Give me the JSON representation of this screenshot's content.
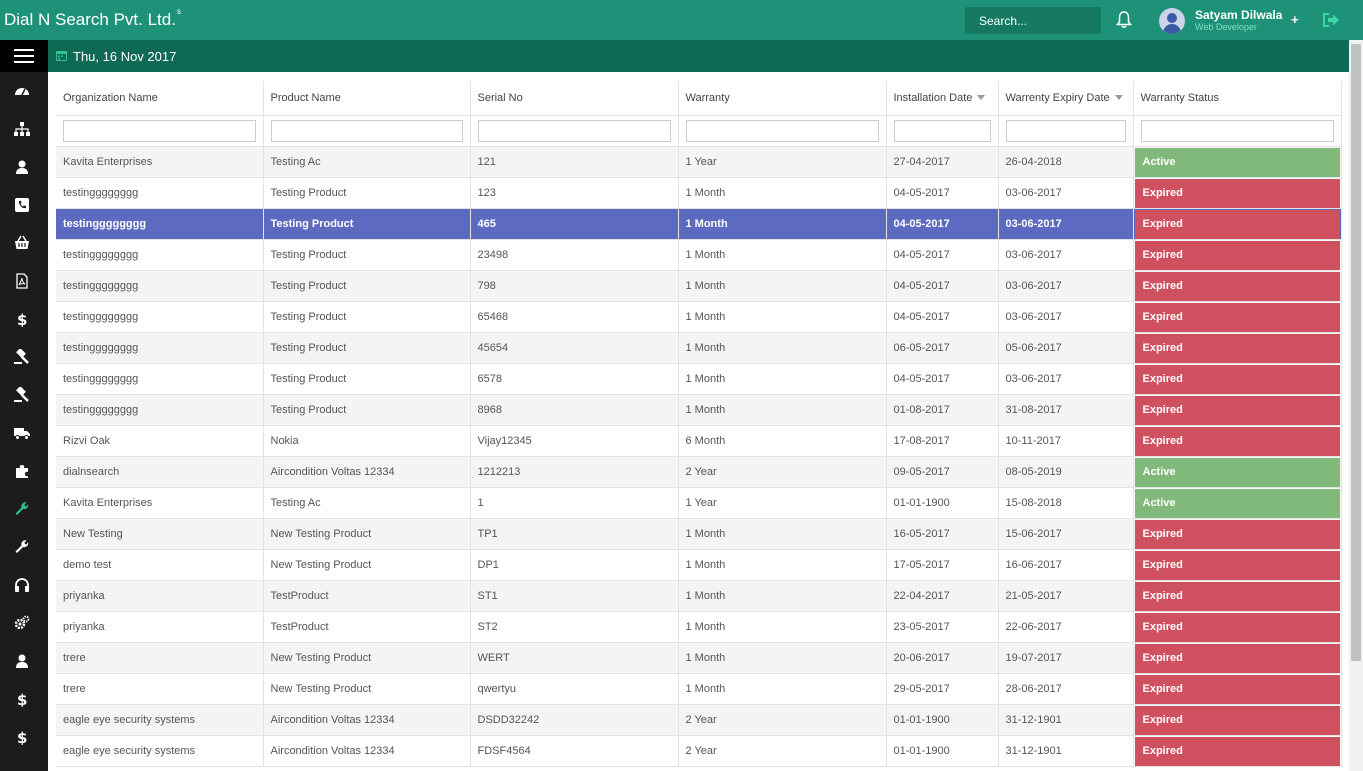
{
  "header": {
    "brand": "Dial N Search Pvt. Ltd.",
    "brand_sup": "s",
    "search_placeholder": "Search...",
    "user_name": "Satyam Dilwala",
    "user_role": "Web Developer",
    "plus": "+"
  },
  "subbar": {
    "date": "Thu, 16 Nov 2017"
  },
  "colors": {
    "topbar": "#1e9278",
    "subbar": "#0f6a55",
    "active": "#81b97a",
    "expired": "#cf505e",
    "selected": "#5c6bc0"
  },
  "sidebar_icons": [
    "dashboard-icon",
    "sitemap-icon",
    "user-icon",
    "phone-icon",
    "basket-icon",
    "pdf-icon",
    "dollar-icon",
    "gavel-icon",
    "gavel-icon",
    "truck-icon",
    "puzzle-icon",
    "wrench-icon",
    "wrench-icon",
    "headphones-icon",
    "cogs-icon",
    "user-icon",
    "dollar-icon",
    "dollar-icon"
  ],
  "table": {
    "columns": [
      "Organization Name",
      "Product Name",
      "Serial No",
      "Warranty",
      "Installation Date",
      "Warrenty Expiry Date",
      "Warranty Status"
    ],
    "rows": [
      {
        "org": "Kavita Enterprises",
        "product": "Testing Ac",
        "serial": "121",
        "warranty": "1 Year",
        "install": "27-04-2017",
        "expiry": "26-04-2018",
        "status": "Active"
      },
      {
        "org": "testingggggggg",
        "product": "Testing Product",
        "serial": "123",
        "warranty": "1 Month",
        "install": "04-05-2017",
        "expiry": "03-06-2017",
        "status": "Expired"
      },
      {
        "org": "testingggggggg",
        "product": "Testing Product",
        "serial": "465",
        "warranty": "1 Month",
        "install": "04-05-2017",
        "expiry": "03-06-2017",
        "status": "Expired",
        "selected": true
      },
      {
        "org": "testingggggggg",
        "product": "Testing Product",
        "serial": "23498",
        "warranty": "1 Month",
        "install": "04-05-2017",
        "expiry": "03-06-2017",
        "status": "Expired"
      },
      {
        "org": "testingggggggg",
        "product": "Testing Product",
        "serial": "798",
        "warranty": "1 Month",
        "install": "04-05-2017",
        "expiry": "03-06-2017",
        "status": "Expired"
      },
      {
        "org": "testingggggggg",
        "product": "Testing Product",
        "serial": "65468",
        "warranty": "1 Month",
        "install": "04-05-2017",
        "expiry": "03-06-2017",
        "status": "Expired"
      },
      {
        "org": "testingggggggg",
        "product": "Testing Product",
        "serial": "45654",
        "warranty": "1 Month",
        "install": "06-05-2017",
        "expiry": "05-06-2017",
        "status": "Expired"
      },
      {
        "org": "testingggggggg",
        "product": "Testing Product",
        "serial": "6578",
        "warranty": "1 Month",
        "install": "04-05-2017",
        "expiry": "03-06-2017",
        "status": "Expired"
      },
      {
        "org": "testingggggggg",
        "product": "Testing Product",
        "serial": "8968",
        "warranty": "1 Month",
        "install": "01-08-2017",
        "expiry": "31-08-2017",
        "status": "Expired"
      },
      {
        "org": "Rizvi Oak",
        "product": "Nokia",
        "serial": "Vijay12345",
        "warranty": "6 Month",
        "install": "17-08-2017",
        "expiry": "10-11-2017",
        "status": "Expired"
      },
      {
        "org": "dialnsearch",
        "product": "Aircondition Voltas 12334",
        "serial": "1212213",
        "warranty": "2 Year",
        "install": "09-05-2017",
        "expiry": "08-05-2019",
        "status": "Active"
      },
      {
        "org": "Kavita Enterprises",
        "product": "Testing Ac",
        "serial": "1",
        "warranty": "1 Year",
        "install": "01-01-1900",
        "expiry": "15-08-2018",
        "status": "Active"
      },
      {
        "org": "New Testing",
        "product": "New Testing Product",
        "serial": "TP1",
        "warranty": "1 Month",
        "install": "16-05-2017",
        "expiry": "15-06-2017",
        "status": "Expired"
      },
      {
        "org": "demo test",
        "product": "New Testing Product",
        "serial": "DP1",
        "warranty": "1 Month",
        "install": "17-05-2017",
        "expiry": "16-06-2017",
        "status": "Expired"
      },
      {
        "org": "priyanka",
        "product": "TestProduct",
        "serial": "ST1",
        "warranty": "1 Month",
        "install": "22-04-2017",
        "expiry": "21-05-2017",
        "status": "Expired"
      },
      {
        "org": "priyanka",
        "product": "TestProduct",
        "serial": "ST2",
        "warranty": "1 Month",
        "install": "23-05-2017",
        "expiry": "22-06-2017",
        "status": "Expired"
      },
      {
        "org": "trere",
        "product": "New Testing Product",
        "serial": "WERT",
        "warranty": "1 Month",
        "install": "20-06-2017",
        "expiry": "19-07-2017",
        "status": "Expired"
      },
      {
        "org": "trere",
        "product": "New Testing Product",
        "serial": "qwertyu",
        "warranty": "1 Month",
        "install": "29-05-2017",
        "expiry": "28-06-2017",
        "status": "Expired"
      },
      {
        "org": "eagle eye security systems",
        "product": "Aircondition Voltas 12334",
        "serial": "DSDD32242",
        "warranty": "2 Year",
        "install": "01-01-1900",
        "expiry": "31-12-1901",
        "status": "Expired"
      },
      {
        "org": "eagle eye security systems",
        "product": "Aircondition Voltas 12334",
        "serial": "FDSF4564",
        "warranty": "2 Year",
        "install": "01-01-1900",
        "expiry": "31-12-1901",
        "status": "Expired"
      }
    ]
  }
}
